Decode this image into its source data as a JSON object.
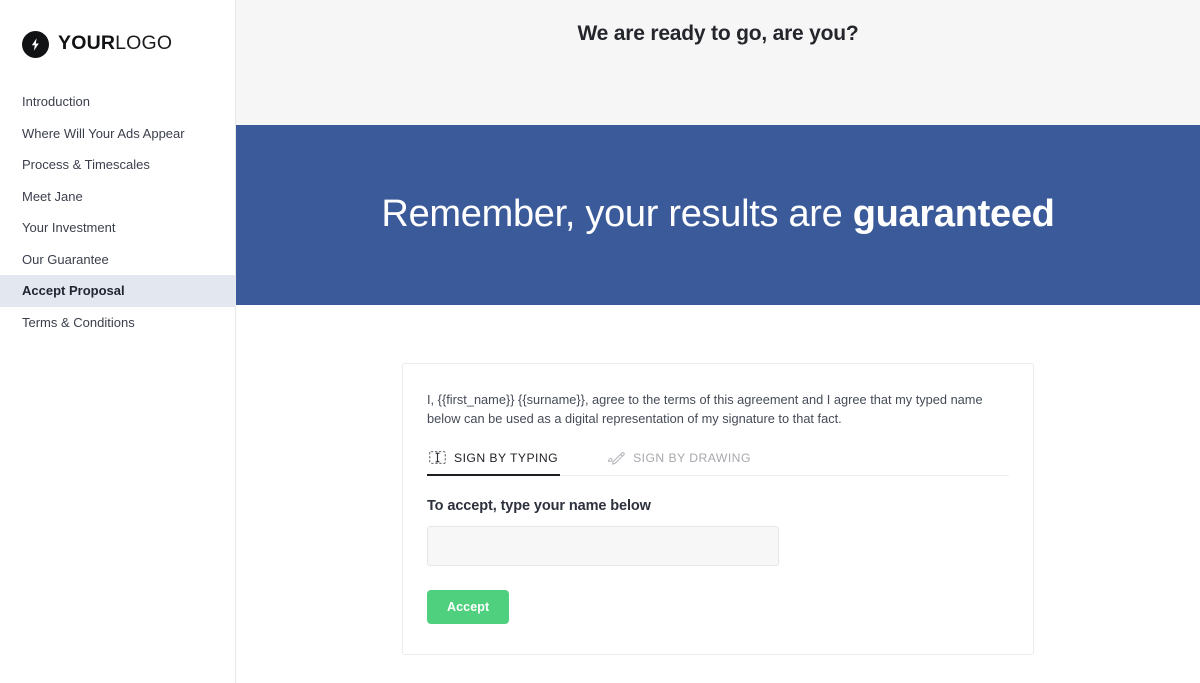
{
  "sidebar": {
    "logo": {
      "icon": "lightning-bolt-icon",
      "text_bold": "YOUR",
      "text_light": "LOGO"
    },
    "items": [
      {
        "label": "Introduction",
        "active": false
      },
      {
        "label": "Where Will Your Ads Appear",
        "active": false
      },
      {
        "label": "Process & Timescales",
        "active": false
      },
      {
        "label": "Meet Jane",
        "active": false
      },
      {
        "label": "Your Investment",
        "active": false
      },
      {
        "label": "Our Guarantee",
        "active": false
      },
      {
        "label": "Accept Proposal",
        "active": true
      },
      {
        "label": "Terms & Conditions",
        "active": false
      }
    ]
  },
  "header": {
    "title": "We are ready to go, are you?"
  },
  "banner": {
    "text_regular": "Remember, your results are ",
    "text_bold": "guaranteed",
    "background_color": "#3b5a9a"
  },
  "card": {
    "agreement_text": "I, {{first_name}} {{surname}}, agree to the terms of this agreement and I agree that my typed name below can be used as a digital representation of my signature to that fact.",
    "tabs": [
      {
        "label": "SIGN BY TYPING",
        "icon": "text-cursor-icon",
        "active": true
      },
      {
        "label": "SIGN BY DRAWING",
        "icon": "pen-draw-icon",
        "active": false
      }
    ],
    "field_label": "To accept, type your name below",
    "name_input": {
      "value": "",
      "placeholder": ""
    },
    "accept_button": {
      "label": "Accept",
      "color": "#4fd07e"
    }
  }
}
